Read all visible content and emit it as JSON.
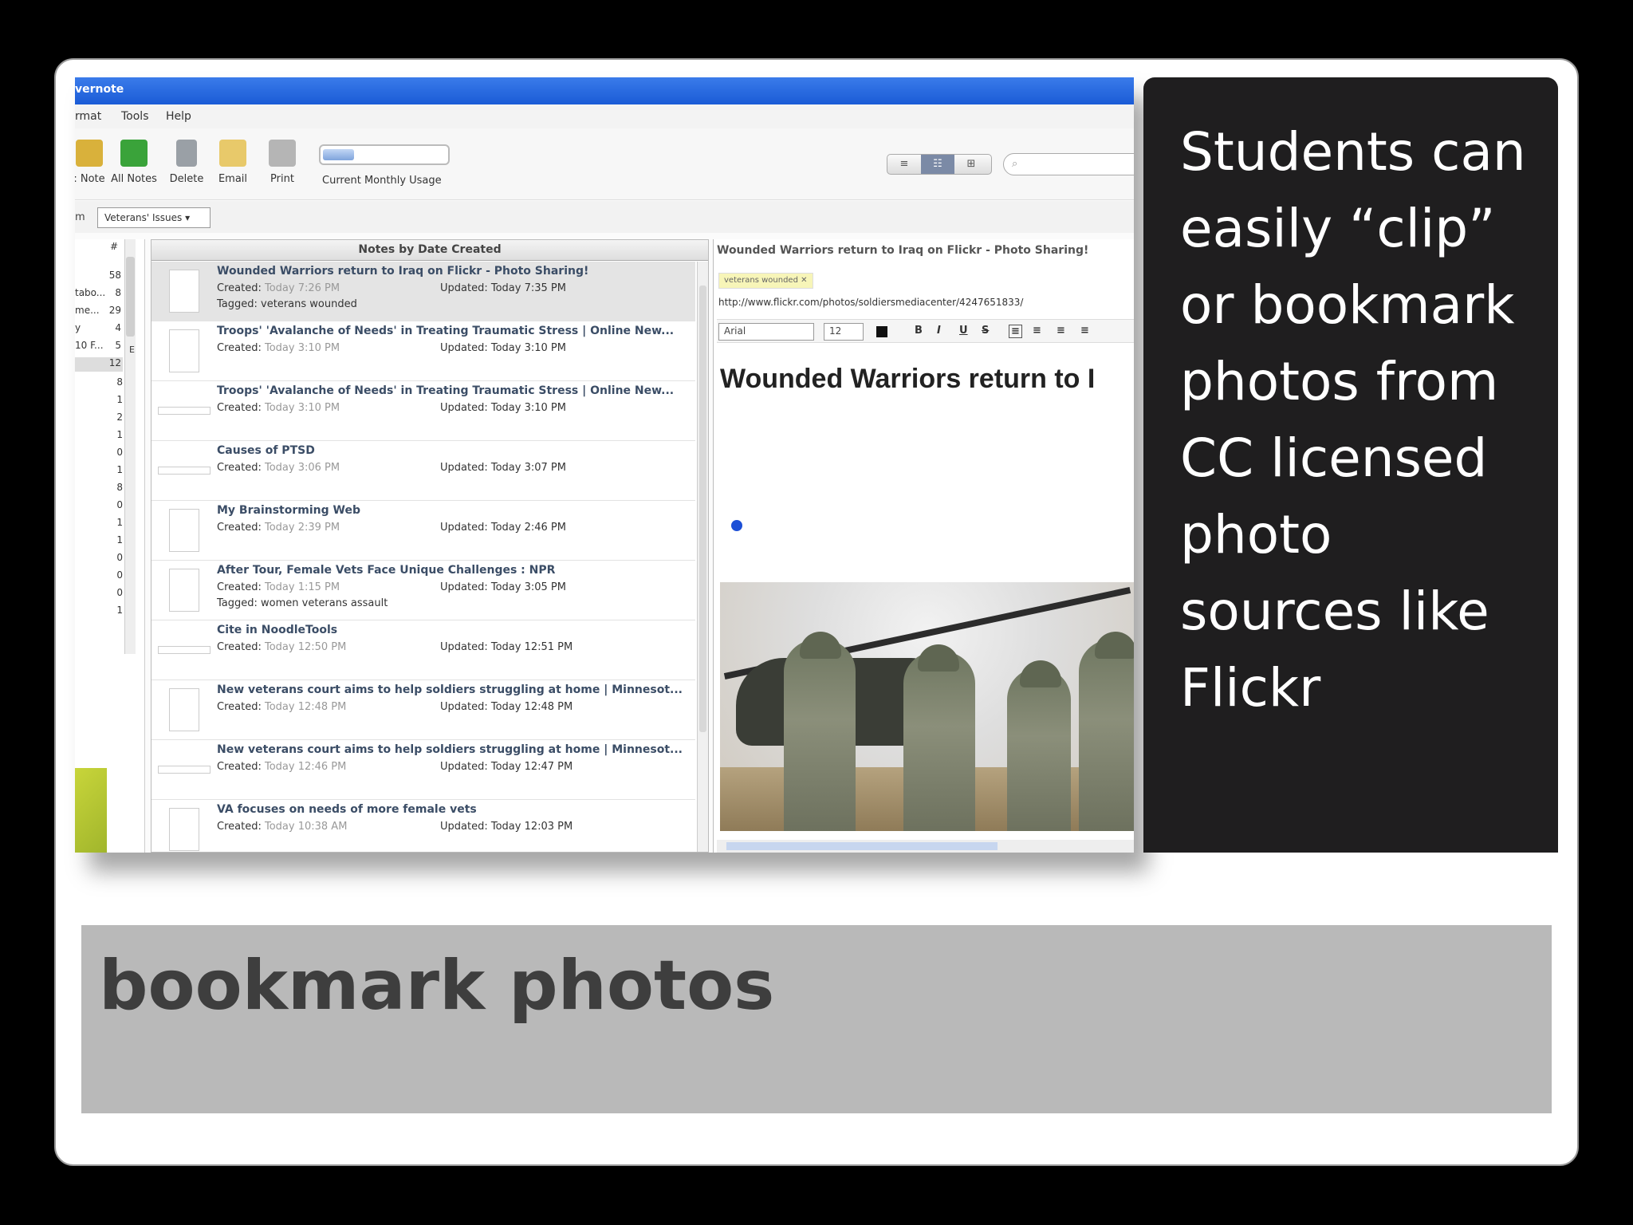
{
  "app": {
    "title": "vernote",
    "menu": [
      "rmat",
      "Tools",
      "Help"
    ],
    "toolbar": {
      "buttons": [
        {
          "label": ": Note",
          "icon": "new-note-icon",
          "color": "#d9b13b"
        },
        {
          "label": "All Notes",
          "icon": "all-notes-icon",
          "color": "#3aa33a"
        },
        {
          "label": "Delete",
          "icon": "trash-icon",
          "color": "#9aa0a6"
        },
        {
          "label": "Email",
          "icon": "envelope-icon",
          "color": "#e8c96a"
        },
        {
          "label": "Print",
          "icon": "printer-icon",
          "color": "#b5b5b5"
        }
      ],
      "usage_label": "Current Monthly Usage",
      "usage_fraction": 0.25,
      "view_buttons": [
        "≡",
        "☷",
        "⊞"
      ],
      "search_icon": "⌕"
    },
    "filter": {
      "prefix": "m",
      "notebook": "Veterans' Issues ▾"
    },
    "left_column": {
      "header_icons": [
        "#",
        "▲"
      ],
      "rows": [
        {
          "name": "",
          "count": "58"
        },
        {
          "name": "tabo...",
          "count": "8"
        },
        {
          "name": "me...",
          "count": "29"
        },
        {
          "name": "y",
          "count": "4"
        },
        {
          "name": "10 F...",
          "count": "5"
        },
        {
          "name": "",
          "count": "12"
        }
      ],
      "numbers": [
        "8",
        "1",
        "2",
        "1",
        "0",
        "1",
        "8",
        "0",
        "1",
        "1",
        "0",
        "0",
        "0",
        "1"
      ],
      "side_letters": [
        "E"
      ]
    },
    "notes_list": {
      "header": "Notes by Date Created",
      "notes": [
        {
          "title": "Wounded Warriors return to Iraq on Flickr - Photo Sharing!",
          "created": "Today 7:26 PM",
          "updated": "Today 7:35 PM",
          "tags": "veterans wounded",
          "selected": true,
          "thumb": "page"
        },
        {
          "title": "Troops' 'Avalanche of Needs' in Treating Traumatic Stress | Online New...",
          "created": "Today 3:10 PM",
          "updated": "Today 3:10 PM",
          "tags": "",
          "selected": false,
          "thumb": "page"
        },
        {
          "title": "Troops' 'Avalanche of Needs' in Treating Traumatic Stress | Online New...",
          "created": "Today 3:10 PM",
          "updated": "Today 3:10 PM",
          "tags": "",
          "selected": false,
          "thumb": "wide"
        },
        {
          "title": "Causes of PTSD",
          "created": "Today 3:06 PM",
          "updated": "Today 3:07 PM",
          "tags": "",
          "selected": false,
          "thumb": "wide"
        },
        {
          "title": "My Brainstorming Web",
          "created": "Today 2:39 PM",
          "updated": "Today 2:46 PM",
          "tags": "",
          "selected": false,
          "thumb": "page"
        },
        {
          "title": "After Tour, Female Vets Face Unique Challenges : NPR",
          "created": "Today 1:15 PM",
          "updated": "Today 3:05 PM",
          "tags": "women veterans assault",
          "selected": false,
          "thumb": "page"
        },
        {
          "title": "Cite in NoodleTools",
          "created": "Today 12:50 PM",
          "updated": "Today 12:51 PM",
          "tags": "",
          "selected": false,
          "thumb": "wide"
        },
        {
          "title": "New veterans court aims to help soldiers struggling at home | Minnesot...",
          "created": "Today 12:48 PM",
          "updated": "Today 12:48 PM",
          "tags": "",
          "selected": false,
          "thumb": "page"
        },
        {
          "title": "New veterans court aims to help soldiers struggling at home | Minnesot...",
          "created": "Today 12:46 PM",
          "updated": "Today 12:47 PM",
          "tags": "",
          "selected": false,
          "thumb": "wide"
        },
        {
          "title": "VA focuses on needs of more female vets",
          "created": "Today 10:38 AM",
          "updated": "Today 12:03 PM",
          "tags": "",
          "selected": false,
          "thumb": "page"
        }
      ],
      "created_label": "Created:",
      "updated_label": "Updated:",
      "tagged_label": "Tagged:"
    },
    "detail": {
      "title": "Wounded Warriors return to Iraq on Flickr - Photo Sharing!",
      "tag_chip": "veterans wounded ✕",
      "url": "http://www.flickr.com/photos/soldiersmediacenter/4247651833/",
      "font": "Arial",
      "font_size": "12",
      "format_buttons": [
        "B",
        "I",
        "U",
        "S",
        "≡",
        "≡",
        "≡",
        "≡"
      ],
      "heading": "Wounded Warriors return to I"
    }
  },
  "callout": {
    "text": "Students can easily “clip” or bookmark photos from CC licensed photo sources like Flickr"
  },
  "slide_title": "bookmark photos",
  "colors": {
    "titlebar": "#1a5bd6",
    "callout_bg": "#1f1e1f",
    "title_band": "#b9b9b9",
    "title_text": "#3e3e3e"
  }
}
